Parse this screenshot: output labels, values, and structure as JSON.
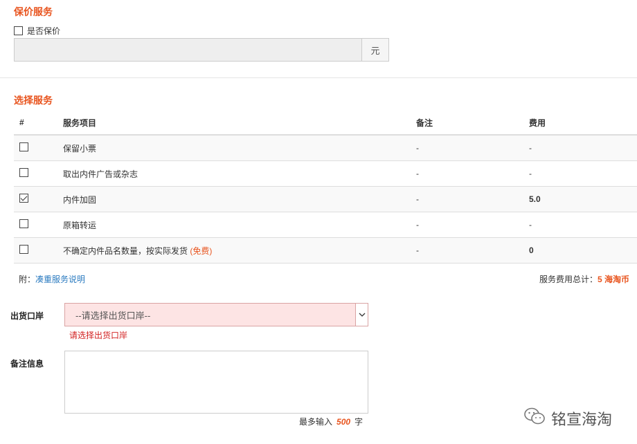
{
  "insure": {
    "title": "保价服务",
    "checkbox_label": "是否保价",
    "checked": false,
    "value": "",
    "unit": "元"
  },
  "services": {
    "title": "选择服务",
    "headers": {
      "index": "#",
      "name": "服务项目",
      "note": "备注",
      "fee": "费用"
    },
    "rows": [
      {
        "checked": false,
        "name": "保留小票",
        "free": "",
        "note": "-",
        "fee": "-"
      },
      {
        "checked": false,
        "name": "取出内件广告或杂志",
        "free": "",
        "note": "-",
        "fee": "-"
      },
      {
        "checked": true,
        "name": "内件加固",
        "free": "",
        "note": "-",
        "fee": "5.0"
      },
      {
        "checked": false,
        "name": "原箱转运",
        "free": "",
        "note": "-",
        "fee": "-"
      },
      {
        "checked": false,
        "name": "不确定内件品名数量，按实际发货",
        "free": "(免费)",
        "note": "-",
        "fee": "0"
      }
    ],
    "footer_prefix": "附：",
    "footer_link": "凑重服务说明",
    "total_label": "服务费用总计：",
    "total_value": "5 海淘币"
  },
  "port": {
    "label": "出货口岸",
    "placeholder": "--请选择出货口岸--",
    "error": "请选择出货口岸"
  },
  "remark": {
    "label": "备注信息",
    "limit_prefix": "最多输入",
    "limit_value": "500",
    "limit_suffix": "字"
  },
  "watermark": {
    "text": "铭宣海淘",
    "icon": "wechat-icon"
  }
}
